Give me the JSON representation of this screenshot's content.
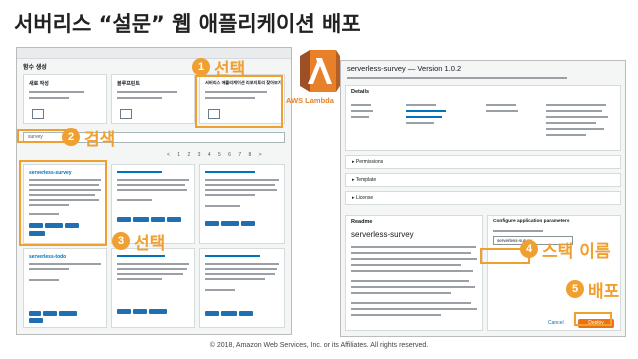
{
  "slide": {
    "title": "서버리스 “설문” 웹 애플리케이션 배포",
    "footer": "© 2018, Amazon Web Services, Inc. or its Affiliates. All rights reserved."
  },
  "logo": {
    "caption": "AWS Lambda"
  },
  "callouts": [
    {
      "number": "1",
      "label": "선택"
    },
    {
      "number": "2",
      "label": "검색"
    },
    {
      "number": "3",
      "label": "선택"
    },
    {
      "number": "4",
      "label": "스택 이름"
    },
    {
      "number": "5",
      "label": "배포"
    }
  ],
  "left_console": {
    "page_heading": "함수 생성",
    "search_value": "survey",
    "pager": "< 1 2 3 4 5 6 7 8 >",
    "top_cards": [
      "새로 작성",
      "블루프린트",
      "서버리스 애플리케이션 리포지토리 찾아보기"
    ],
    "result_cards": [
      "serverless-survey",
      "",
      "",
      "serverless-todo",
      "",
      ""
    ]
  },
  "right_console": {
    "title": "serverless-survey — Version 1.0.2",
    "details_heading": "Details",
    "sections": [
      "Permissions",
      "Template",
      "License"
    ],
    "readme_heading": "Readme",
    "readme_app": "serverless-survey",
    "config_heading": "Configure application parameters",
    "stack_name_value": "serverless-survey",
    "cancel_label": "Cancel",
    "deploy_label": "Deploy"
  },
  "colors": {
    "accent": "#f0a030",
    "lambda_orange": "#e8802a",
    "deploy": "#ec7211"
  }
}
